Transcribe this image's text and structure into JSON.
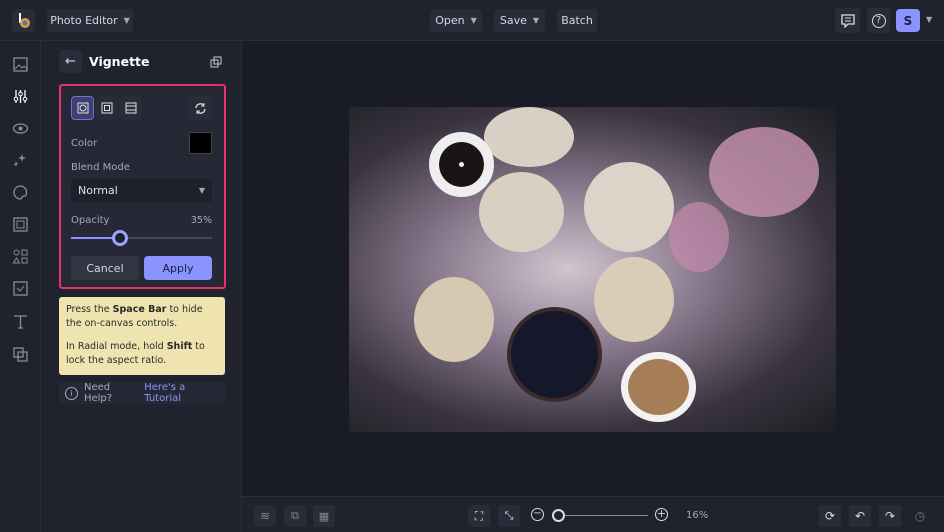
{
  "topbar": {
    "app_menu": "Photo Editor",
    "open": "Open",
    "save": "Save",
    "batch": "Batch",
    "avatar_initial": "S"
  },
  "rail": {
    "icons": [
      "image-icon",
      "adjustments-icon",
      "eye-icon",
      "sparkle-icon",
      "palette-icon",
      "frame-icon",
      "shapes-icon",
      "texture-icon",
      "text-icon",
      "overlay-icon"
    ]
  },
  "panel": {
    "title": "Vignette",
    "color_label": "Color",
    "color_value": "#000000",
    "blend_label": "Blend Mode",
    "blend_value": "Normal",
    "opacity_label": "Opacity",
    "opacity_value": "35%",
    "opacity_fraction": 0.35,
    "cancel": "Cancel",
    "apply": "Apply"
  },
  "tip": {
    "p1_a": "Press the ",
    "p1_b": "Space Bar",
    "p1_c": " to hide the on-canvas controls.",
    "p2_a": "In Radial mode, hold ",
    "p2_b": "Shift",
    "p2_c": " to lock the aspect ratio."
  },
  "help": {
    "text": "Need Help?",
    "link": "Here's a Tutorial"
  },
  "bottom": {
    "zoom": "16%",
    "zoom_fraction": 0.03
  },
  "colors": {
    "accent": "#8b93ff",
    "highlight": "#e8316b",
    "tip_bg": "#efe4b0"
  }
}
